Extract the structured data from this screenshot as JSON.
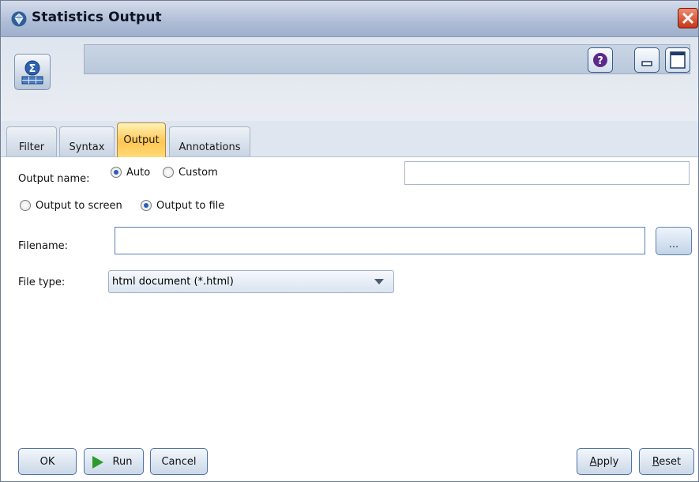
{
  "window": {
    "title": "Statistics Output",
    "app_icon": "gem-icon",
    "close_icon": "close-icon"
  },
  "header": {
    "node_icon": "statistics-node-icon",
    "node_name": "",
    "help_icon": "help-icon",
    "minimize_icon": "minimize-icon",
    "maximize_icon": "maximize-icon"
  },
  "tabs": [
    {
      "label": "Filter",
      "active": false
    },
    {
      "label": "Syntax",
      "active": false
    },
    {
      "label": "Output",
      "active": true
    },
    {
      "label": "Annotations",
      "active": false
    }
  ],
  "output_name": {
    "label": "Output name:",
    "options": [
      {
        "label": "Auto",
        "checked": true
      },
      {
        "label": "Custom",
        "checked": false
      }
    ],
    "custom_value": ""
  },
  "output_mode": {
    "options": [
      {
        "label": "Output to screen",
        "checked": false
      },
      {
        "label": "Output to file",
        "checked": true
      }
    ]
  },
  "filename": {
    "label": "Filename:",
    "value": "",
    "browse_label": "..."
  },
  "file_type": {
    "label": "File type:",
    "selected": "html document (*.html)"
  },
  "footer": {
    "ok_label": "OK",
    "run_label": "Run",
    "cancel_label": "Cancel",
    "apply_label": "Apply",
    "apply_mnemonic": "A",
    "apply_rest": "pply",
    "reset_label": "Reset",
    "reset_mnemonic": "R",
    "reset_rest": "eset"
  },
  "colors": {
    "active_tab": "#ffc651",
    "titlebar": "#aebdd6",
    "button_border": "#4d72a7",
    "radio_dot": "#2a5cbf",
    "run_icon": "#2e9a2e",
    "close_button": "#c8361a"
  }
}
